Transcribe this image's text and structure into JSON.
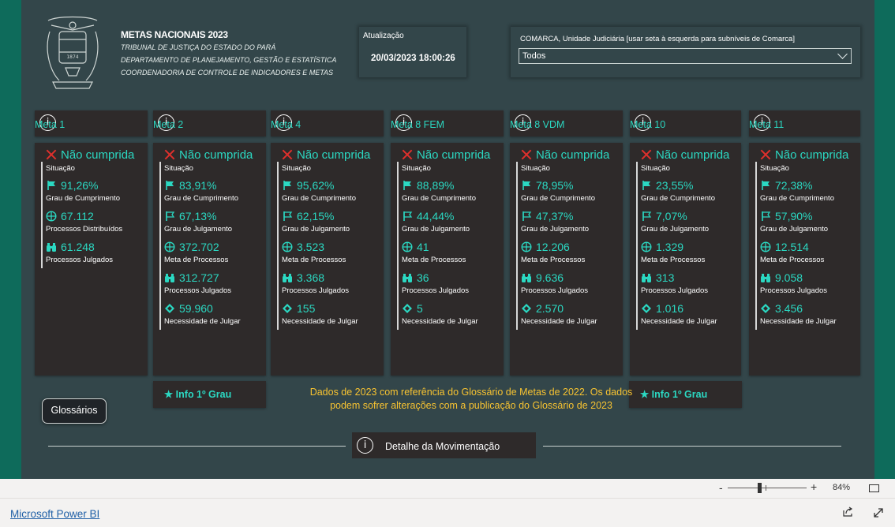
{
  "header": {
    "title": "METAS NACIONAIS 2023",
    "lines": [
      "TRIBUNAL DE JUSTIÇA DO ESTADO DO PARÁ",
      "DEPARTAMENTO DE PLANEJAMENTO, GESTÃO E ESTATÍSTICA",
      "COORDENADORIA DE CONTROLE DE INDICADORES E METAS"
    ],
    "seal_text": "1874"
  },
  "update": {
    "label": "Atualização",
    "value": "20/03/2023 18:00:26"
  },
  "filter": {
    "label": "COMARCA, Unidade Judiciária [usar seta à esquerda para subníveis de Comarca]",
    "value": "Todos"
  },
  "info_glyph": "i",
  "metas": [
    {
      "name": "Meta 1",
      "status": "Não cumprida",
      "status_label": "Situação",
      "rows": [
        {
          "icon": "flag-filled-icon",
          "value": "91,26%",
          "label": "Grau de Cumprimento"
        },
        {
          "icon": "crosshair-icon",
          "value": "67.112",
          "label": "Processos Distribuídos"
        },
        {
          "icon": "binoculars-icon",
          "value": "61.248",
          "label": "Processos Julgados"
        }
      ]
    },
    {
      "name": "Meta 2",
      "status": "Não cumprida",
      "status_label": "Situação",
      "rows": [
        {
          "icon": "flag-filled-icon",
          "value": "83,91%",
          "label": "Grau de Cumprimento"
        },
        {
          "icon": "flag-outline-icon",
          "value": "67,13%",
          "label": "Grau de Julgamento"
        },
        {
          "icon": "crosshair-icon",
          "value": "372.702",
          "label": "Meta de Processos"
        },
        {
          "icon": "binoculars-icon",
          "value": "312.727",
          "label": "Processos Julgados"
        },
        {
          "icon": "diamond-icon",
          "value": "59.960",
          "label": "Necessidade de Julgar"
        }
      ]
    },
    {
      "name": "Meta 4",
      "status": "Não cumprida",
      "status_label": "Situação",
      "rows": [
        {
          "icon": "flag-filled-icon",
          "value": "95,62%",
          "label": "Grau de Cumprimento"
        },
        {
          "icon": "flag-outline-icon",
          "value": "62,15%",
          "label": "Grau de Julgamento"
        },
        {
          "icon": "crosshair-icon",
          "value": "3.523",
          "label": "Meta de Processos"
        },
        {
          "icon": "binoculars-icon",
          "value": "3.368",
          "label": "Processos Julgados"
        },
        {
          "icon": "diamond-icon",
          "value": "155",
          "label": "Necessidade de Julgar"
        }
      ]
    },
    {
      "name": "Meta 8 FEM",
      "status": "Não cumprida",
      "status_label": "Situação",
      "rows": [
        {
          "icon": "flag-filled-icon",
          "value": "88,89%",
          "label": "Grau de Cumprimento"
        },
        {
          "icon": "flag-outline-icon",
          "value": "44,44%",
          "label": "Grau de Julgamento"
        },
        {
          "icon": "crosshair-icon",
          "value": "41",
          "label": "Meta de Processos"
        },
        {
          "icon": "binoculars-icon",
          "value": "36",
          "label": "Processos Julgados"
        },
        {
          "icon": "diamond-icon",
          "value": "5",
          "label": "Necessidade de Julgar"
        }
      ]
    },
    {
      "name": "Meta 8 VDM",
      "status": "Não cumprida",
      "status_label": "Situação",
      "rows": [
        {
          "icon": "flag-filled-icon",
          "value": "78,95%",
          "label": "Grau de Cumprimento"
        },
        {
          "icon": "flag-outline-icon",
          "value": "47,37%",
          "label": "Grau de Julgamento"
        },
        {
          "icon": "crosshair-icon",
          "value": "12.206",
          "label": "Meta de Processos"
        },
        {
          "icon": "binoculars-icon",
          "value": "9.636",
          "label": "Processos Julgados"
        },
        {
          "icon": "diamond-icon",
          "value": "2.570",
          "label": "Necessidade de Julgar"
        }
      ]
    },
    {
      "name": "Meta 10",
      "status": "Não cumprida",
      "status_label": "Situação",
      "rows": [
        {
          "icon": "flag-filled-icon",
          "value": "23,55%",
          "label": "Grau de Cumprimento"
        },
        {
          "icon": "flag-outline-icon",
          "value": "7,07%",
          "label": "Grau de Julgamento"
        },
        {
          "icon": "crosshair-icon",
          "value": "1.329",
          "label": "Meta de Processos"
        },
        {
          "icon": "binoculars-icon",
          "value": "313",
          "label": "Processos Julgados"
        },
        {
          "icon": "diamond-icon",
          "value": "1.016",
          "label": "Necessidade de Julgar"
        }
      ]
    },
    {
      "name": "Meta 11",
      "status": "Não cumprida",
      "status_label": "Situação",
      "rows": [
        {
          "icon": "flag-filled-icon",
          "value": "72,38%",
          "label": "Grau de Cumprimento"
        },
        {
          "icon": "flag-outline-icon",
          "value": "57,90%",
          "label": "Grau de Julgamento"
        },
        {
          "icon": "crosshair-icon",
          "value": "12.514",
          "label": "Meta de Processos"
        },
        {
          "icon": "binoculars-icon",
          "value": "9.058",
          "label": "Processos Julgados"
        },
        {
          "icon": "diamond-icon",
          "value": "3.456",
          "label": "Necessidade de Julgar"
        }
      ]
    }
  ],
  "info_buttons": {
    "label": "★ Info 1º Grau"
  },
  "note": "Dados de 2023 com referência do Glossário de Metas de 2022. Os dados podem sofrer alterações com a publicação do Glossário de 2023",
  "glossary_button": "Glossários",
  "detail_button": "Detalhe da Movimentação",
  "zoom": {
    "minus": "-",
    "plus": "+",
    "value": "84%",
    "level": 0.4
  },
  "footer": {
    "link": "Microsoft Power BI"
  },
  "colors": {
    "accent": "#2bd8c2",
    "frame": "#0e6b5b",
    "canvas": "#33464a",
    "card": "#2e2a2a",
    "note": "#f7c331",
    "status_x": "#e0302c"
  }
}
